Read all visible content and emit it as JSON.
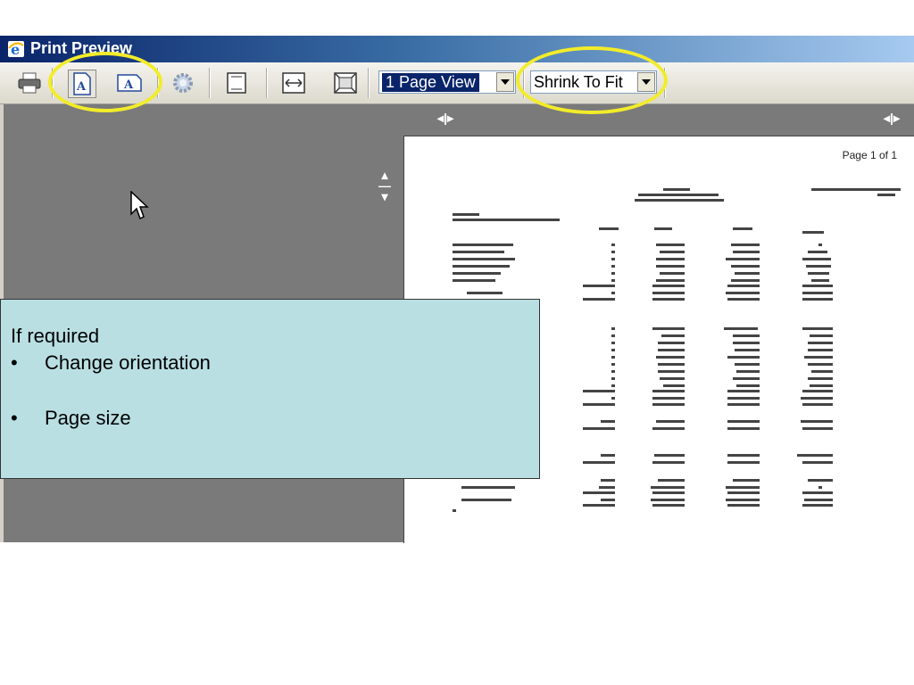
{
  "window": {
    "title": "Print Preview"
  },
  "toolbar": {
    "icons": [
      "printer-icon",
      "portrait-icon",
      "landscape-icon",
      "page-setup-gear-icon",
      "header-footer-icon",
      "full-width-icon",
      "full-page-icon"
    ],
    "view_select": {
      "value": "1 Page View"
    },
    "fit_select": {
      "value": "Shrink To Fit"
    }
  },
  "preview": {
    "page_label": "Page 1 of 1"
  },
  "callout": {
    "heading": "If required",
    "items": [
      "Change orientation",
      "Page size"
    ],
    "bullet": "•"
  },
  "colors": {
    "highlight": "#f2ec2a",
    "callout_bg": "#b9dfe3",
    "canvas": "#7a7a7a"
  }
}
